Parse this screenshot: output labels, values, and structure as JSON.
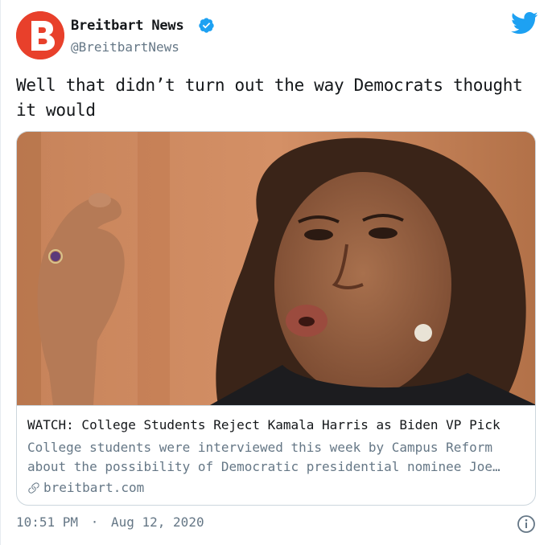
{
  "author": {
    "name": "Breitbart News",
    "handle": "@BreitbartNews",
    "avatar_letter": "B",
    "avatar_color": "#e8402b",
    "verified": true
  },
  "tweet": {
    "text": "Well that didn’t turn out the way Democrats thought it would"
  },
  "card": {
    "title": "WATCH: College Students Reject Kamala Harris as Biden VP Pick",
    "description": "College students were interviewed this week by Campus Reform about the possibility of Democratic presidential nominee Joe…",
    "domain": "breitbart.com",
    "image_alt": "photo of a woman speaking"
  },
  "footer": {
    "time": "10:51 PM",
    "separator": "·",
    "date": "Aug 12, 2020"
  },
  "colors": {
    "twitter_blue": "#1da1f2",
    "secondary_text": "#657786",
    "border": "#ccd6dd"
  },
  "icons": [
    "verified-badge-icon",
    "twitter-bird-icon",
    "link-icon",
    "info-icon"
  ]
}
